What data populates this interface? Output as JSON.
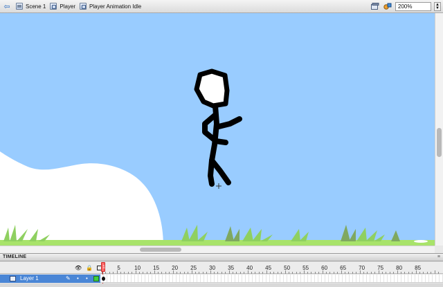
{
  "editbar": {
    "back_icon": "back-arrow-icon",
    "breadcrumbs": [
      {
        "label": "Scene 1",
        "icon": "scene-icon"
      },
      {
        "label": "Player",
        "icon": "movieclip-symbol-icon"
      },
      {
        "label": "Player Animation Idle",
        "icon": "movieclip-symbol-icon"
      }
    ],
    "zoom": "200%"
  },
  "stage": {
    "background": "#99ccff",
    "ground_color": "#a8e36a",
    "cloud_color": "#ffffff",
    "character": "stick-figure"
  },
  "timeline": {
    "panel_title": "TIMELINE",
    "ruler_labels": [
      "5",
      "10",
      "15",
      "20",
      "25",
      "30",
      "35",
      "40",
      "45",
      "50",
      "55",
      "60",
      "65",
      "70",
      "75",
      "80",
      "85"
    ],
    "current_frame": "1",
    "layers": [
      {
        "name": "Layer 1",
        "outline_color": "#3ecf3e"
      }
    ]
  }
}
